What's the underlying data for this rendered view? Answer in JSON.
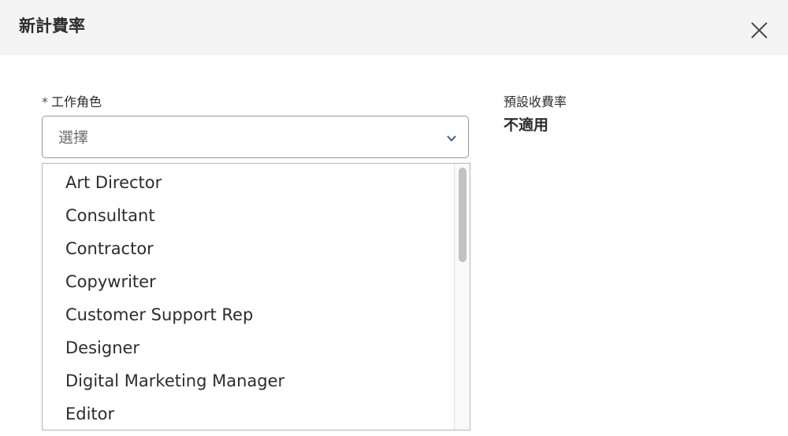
{
  "dialog": {
    "title": "新計費率"
  },
  "job_role": {
    "required_mark": "*",
    "label": "工作角色",
    "placeholder": "選擇",
    "options": [
      "Art Director",
      "Consultant",
      "Contractor",
      "Copywriter",
      "Customer Support Rep",
      "Designer",
      "Digital Marketing Manager",
      "Editor"
    ]
  },
  "default_rate": {
    "label": "預設收費率",
    "value": "不適用"
  },
  "icons": {
    "close": "close-icon",
    "chevron": "chevron-down-icon"
  },
  "colors": {
    "header_bg": "#f4f4f4",
    "chevron": "#2b5797",
    "text": "#2c2c2c"
  }
}
